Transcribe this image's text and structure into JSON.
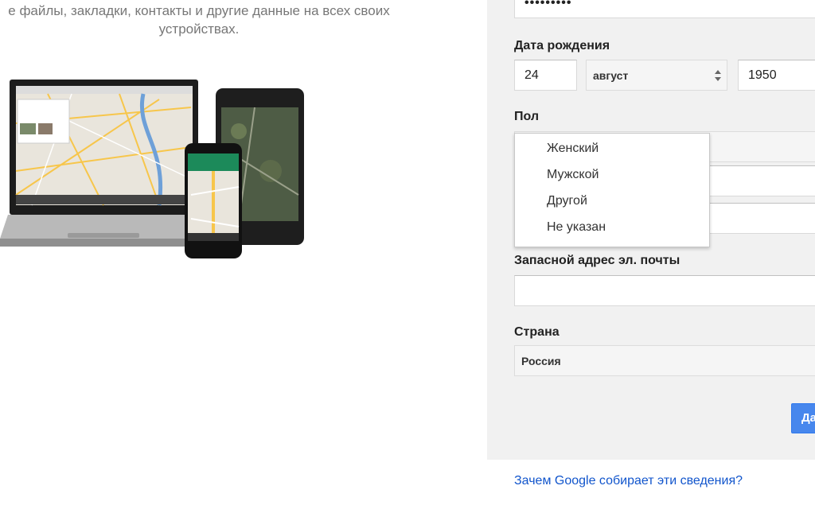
{
  "intro": {
    "line1": "е файлы, закладки, контакты и другие данные на всех своих",
    "line2": "устройствах."
  },
  "devices_image": {
    "name": "devices-illustration",
    "map_colors": [
      "#e9e5dc",
      "#f7c64b",
      "#6ea0d8"
    ]
  },
  "form": {
    "password_masked": "•••••••••",
    "birthdate": {
      "label": "Дата рождения",
      "day": "24",
      "month": "август",
      "year": "1950"
    },
    "gender": {
      "label": "Пол",
      "options": [
        "Женский",
        "Мужской",
        "Другой",
        "Не указан"
      ]
    },
    "backup_email": {
      "label": "Запасной адрес эл. почты",
      "value": ""
    },
    "country": {
      "label": "Страна",
      "value": "Россия"
    },
    "next_button": "Да"
  },
  "footer": {
    "why_link": "Зачем Google собирает эти сведения?"
  },
  "colors": {
    "panel_bg": "#f1f1f1",
    "link": "#1155cc",
    "button": "#4787ed"
  }
}
